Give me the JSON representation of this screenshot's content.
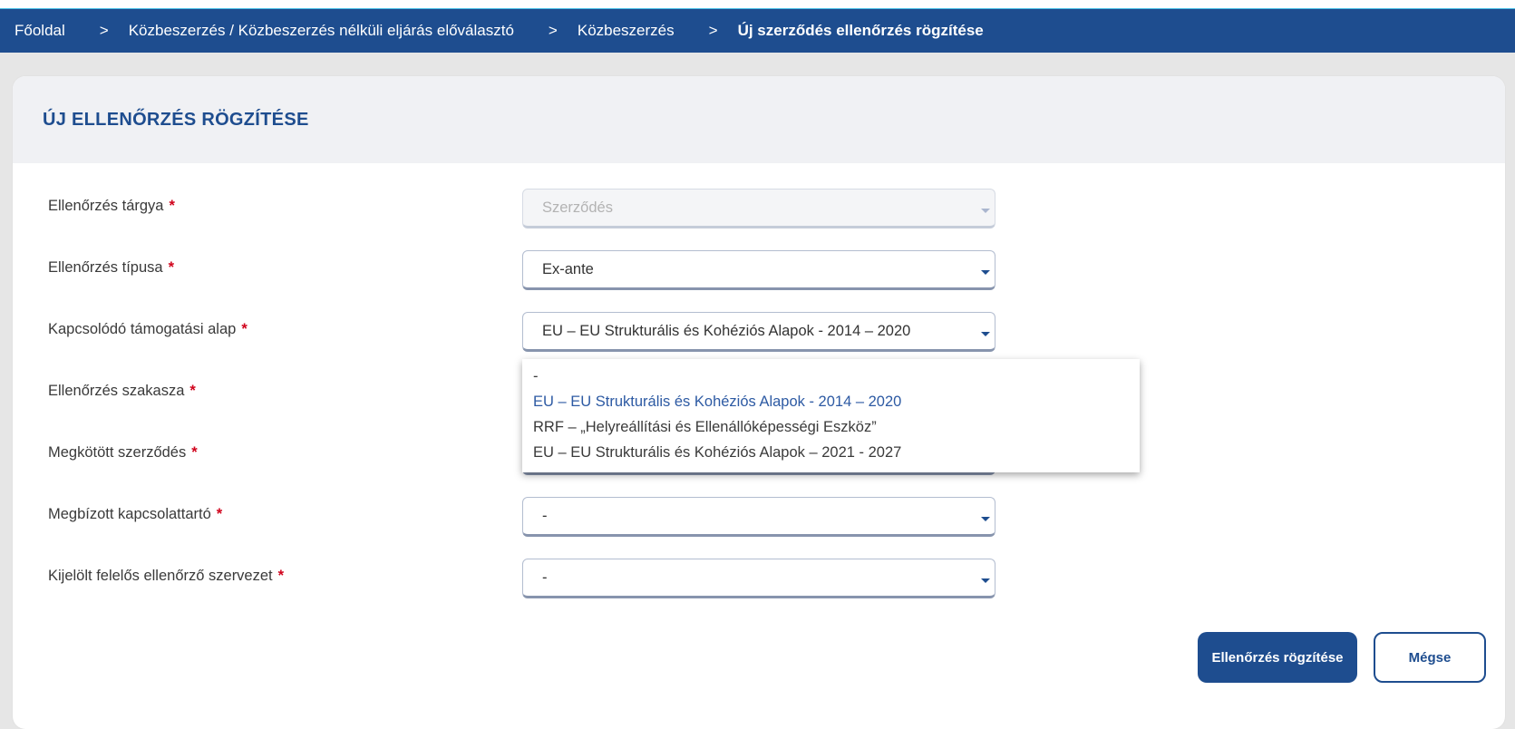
{
  "breadcrumb": {
    "items": [
      "Főoldal",
      "Közbeszerzés / Közbeszerzés nélküli eljárás előválasztó",
      "Közbeszerzés",
      "Új szerződés ellenőrzés rögzítése"
    ],
    "separator": ">"
  },
  "card": {
    "title": "ÚJ ELLENŐRZÉS RÖGZÍTÉSE"
  },
  "form": {
    "required_mark": "*",
    "fields": [
      {
        "label": "Ellenőrzés tárgya",
        "value": "Szerződés",
        "disabled": true
      },
      {
        "label": "Ellenőrzés típusa",
        "value": "Ex-ante"
      },
      {
        "label": "Kapcsolódó támogatási alap",
        "value": "EU – EU Strukturális és Kohéziós Alapok - 2014 – 2020",
        "open": true
      },
      {
        "label": "Ellenőrzés szakasza",
        "value": ""
      },
      {
        "label": "Megkötött szerződés",
        "value": ""
      },
      {
        "label": "Megbízott kapcsolattartó",
        "value": "-"
      },
      {
        "label": "Kijelölt felelős ellenőrző szervezet",
        "value": "-"
      }
    ]
  },
  "dropdown": {
    "options": [
      "-",
      "EU – EU Strukturális és Kohéziós Alapok - 2014 – 2020",
      "RRF – „Helyreállítási és Ellenállóképességi Eszköz”",
      "EU – EU Strukturális és Kohéziós Alapok – 2021 - 2027"
    ],
    "selected_index": 1
  },
  "buttons": {
    "submit": "Ellenőrzés rögzítése",
    "cancel": "Mégse"
  },
  "colors": {
    "brand": "#1e4d8f",
    "required": "#d0021b",
    "selected_option": "#2d5aa3"
  }
}
